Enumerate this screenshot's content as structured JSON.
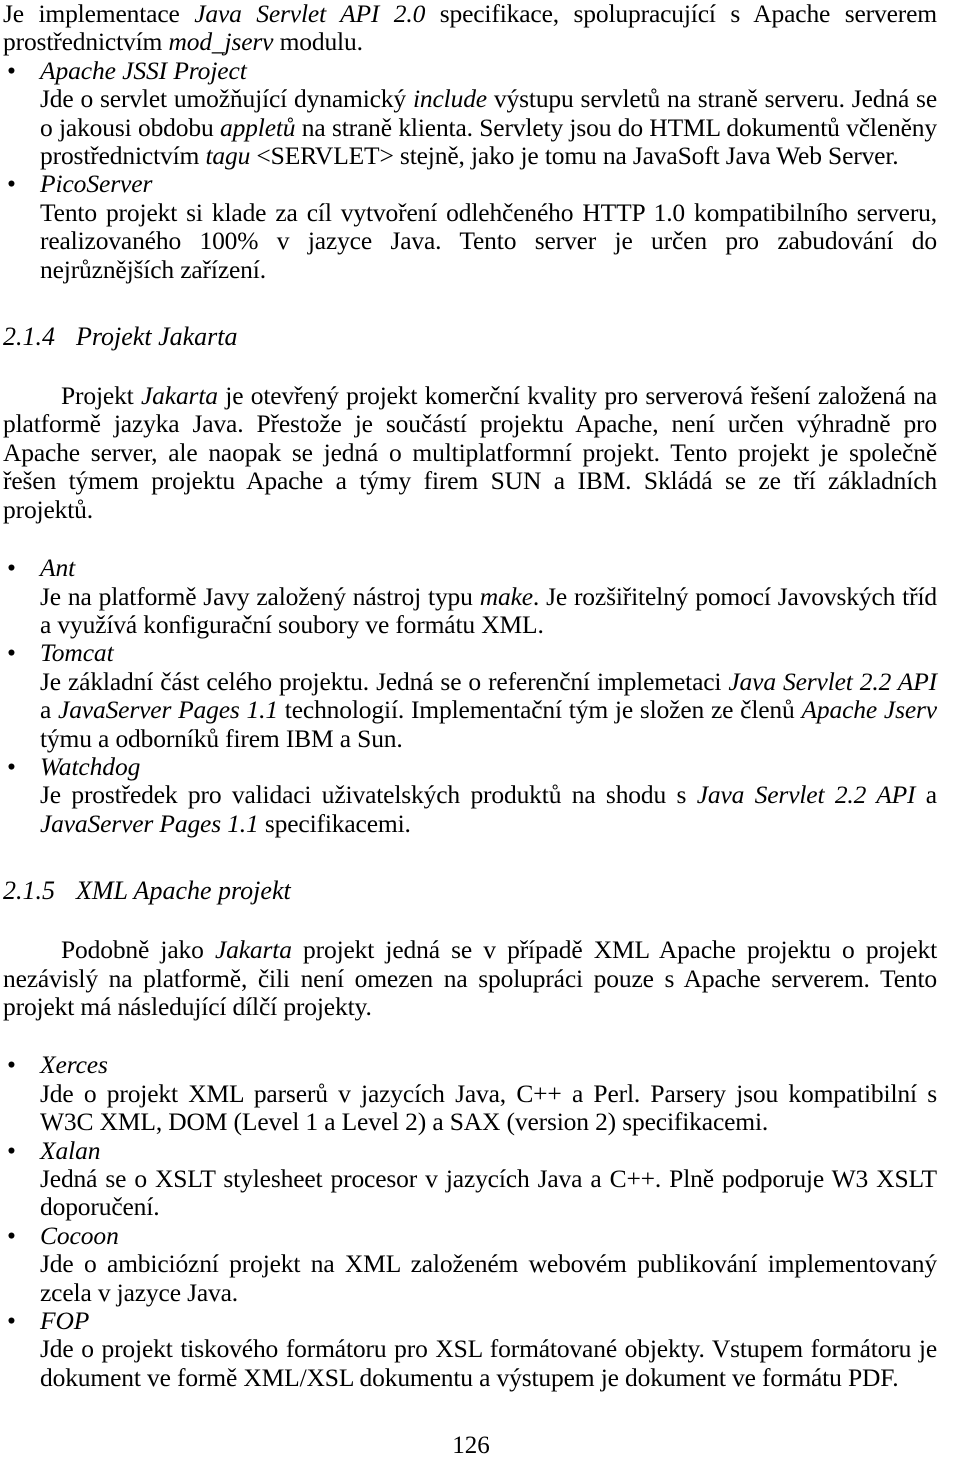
{
  "page": {
    "number": "126",
    "language": "cs"
  },
  "bullet_marker": "•",
  "intro": {
    "para_part1": "Je implementace ",
    "para_em1": "Java Servlet API 2.0",
    "para_part2": " specifikace, spolupracující s Apache serverem prostřednictvím ",
    "para_em2": "mod_jserv",
    "para_part3": " modulu."
  },
  "apache_items": [
    {
      "title": "Apache JSSI Project",
      "body_part1": "Jde o servlet umožňující dynamický ",
      "body_em1": "include",
      "body_part2": " výstupu servletů na straně serveru. Jedná se o jakousi obdobu ",
      "body_em2": "appletů",
      "body_part3": " na straně klienta. Servlety jsou do HTML dokumentů včleněny prostřednictvím ",
      "body_em3": "tagu",
      "body_part4": " <SERVLET> stejně, jako je tomu na JavaSoft Java Web Server."
    },
    {
      "title": "PicoServer",
      "body_part1": "Tento projekt si klade za cíl vytvoření odlehčeného HTTP 1.0 kompatibilního serveru, realizovaného 100% v jazyce Java. Tento server je určen pro zabudování do nejrůznějších zařízení.",
      "body_em1": "",
      "body_part2": "",
      "body_em2": "",
      "body_part3": "",
      "body_em3": "",
      "body_part4": ""
    }
  ],
  "section_jakarta": {
    "number": "2.1.4",
    "title": "Projekt Jakarta",
    "intro_part1": "Projekt ",
    "intro_em1": "Jakarta",
    "intro_part2": " je otevřený projekt komerční kvality pro serverová řešení založená na platformě jazyka Java. Přestože je součástí projektu Apache, není určen výhradně pro Apache server, ale naopak se jedná o multiplatformní projekt. Tento projekt je společně řešen týmem projektu Apache a týmy firem SUN a IBM. Skládá se ze tří základních projektů."
  },
  "jakarta_items": [
    {
      "title": "Ant",
      "body_part1": "Je na platformě Javy založený nástroj typu ",
      "body_em1": "make",
      "body_part2": ". Je rozšiřitelný pomocí Javovských tříd a využívá konfigurační soubory ve formátu XML.",
      "body_em2": "",
      "body_part3": "",
      "body_em3": "",
      "body_part4": ""
    },
    {
      "title": "Tomcat",
      "body_part1": "Je základní část celého projektu. Jedná se o referenční implemetaci ",
      "body_em1": "Java Servlet 2.2 API",
      "body_part2": " a ",
      "body_em2": "JavaServer Pages 1.1",
      "body_part3": " technologií. Implementační tým je složen ze členů ",
      "body_em3": "Apache Jserv",
      "body_part4": " týmu a odborníků firem IBM a Sun."
    },
    {
      "title": "Watchdog",
      "body_part1": "Je prostředek pro validaci uživatelských produktů na shodu s ",
      "body_em1": "Java Servlet 2.2 API",
      "body_part2": "  a ",
      "body_em2": "JavaServer Pages 1.1",
      "body_part3": " specifikacemi.",
      "body_em3": "",
      "body_part4": ""
    }
  ],
  "section_xml": {
    "number": "2.1.5",
    "title": "XML Apache projekt",
    "intro_part1": "Podobně jako ",
    "intro_em1": "Jakarta",
    "intro_part2": " projekt jedná se v případě XML Apache projektu o projekt nezávislý na platformě, čili není omezen na spolupráci pouze s Apache serverem. Tento projekt má následující dílčí projekty."
  },
  "xml_items": [
    {
      "title": "Xerces",
      "body_part1": "Jde o projekt XML parserů v jazycích Java, C++ a Perl. Parsery jsou kompatibilní s W3C XML, DOM (Level 1 a Level 2) a SAX (version 2) specifikacemi.",
      "body_em1": "",
      "body_part2": "",
      "body_em2": "",
      "body_part3": "",
      "body_em3": "",
      "body_part4": ""
    },
    {
      "title": "Xalan",
      "body_part1": "Jedná se o XSLT stylesheet procesor v jazycích Java a C++. Plně podporuje W3 XSLT doporučení.",
      "body_em1": "",
      "body_part2": "",
      "body_em2": "",
      "body_part3": "",
      "body_em3": "",
      "body_part4": ""
    },
    {
      "title": "Cocoon",
      "body_part1": "Jde o ambiciózní projekt na XML založeném webovém publikování implementovaný zcela v jazyce Java.",
      "body_em1": "",
      "body_part2": "",
      "body_em2": "",
      "body_part3": "",
      "body_em3": "",
      "body_part4": ""
    },
    {
      "title": "FOP",
      "body_part1": "Jde o projekt tiskového formátoru pro XSL formátované objekty. Vstupem formátoru je dokument ve formě XML/XSL dokumentu a výstupem je dokument ve formátu PDF.",
      "body_em1": "",
      "body_part2": "",
      "body_em2": "",
      "body_part3": "",
      "body_em3": "",
      "body_part4": ""
    }
  ]
}
